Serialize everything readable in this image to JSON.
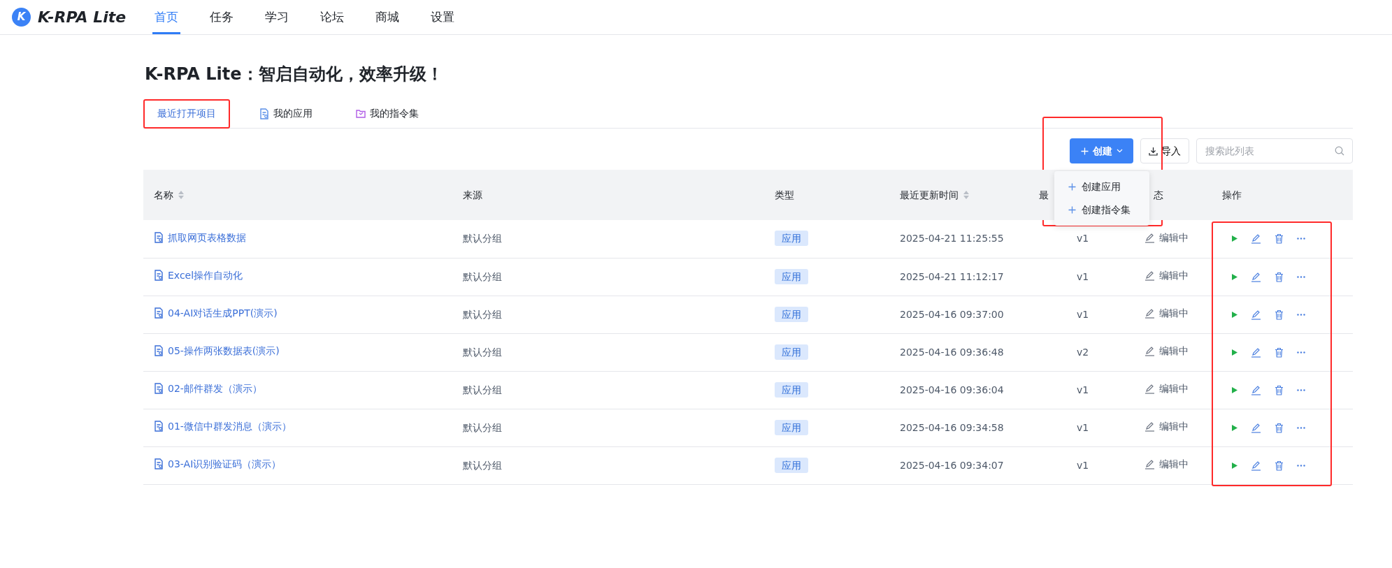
{
  "app": {
    "logo_letter": "K",
    "name": "K-RPA Lite"
  },
  "nav": [
    {
      "label": "首页",
      "selected": true
    },
    {
      "label": "任务",
      "selected": false
    },
    {
      "label": "学习",
      "selected": false
    },
    {
      "label": "论坛",
      "selected": false
    },
    {
      "label": "商城",
      "selected": false
    },
    {
      "label": "设置",
      "selected": false
    }
  ],
  "heading": "K-RPA Lite：智启自动化，效率升级！",
  "tabs": [
    {
      "label": "最近打开项目",
      "kind": "recent",
      "selected": true,
      "highlighted": true
    },
    {
      "label": "我的应用",
      "kind": "app",
      "selected": false,
      "highlighted": false
    },
    {
      "label": "我的指令集",
      "kind": "set",
      "selected": false,
      "highlighted": false
    }
  ],
  "toolbar": {
    "create": {
      "label": "创建",
      "highlighted": true
    },
    "import": {
      "label": "导入"
    },
    "search": {
      "placeholder": "搜索此列表"
    }
  },
  "create_menu": {
    "open": true,
    "items": [
      "创建应用",
      "创建指令集"
    ]
  },
  "table": {
    "actions_highlighted": true,
    "columns": [
      {
        "label": "名称",
        "sortable": true
      },
      {
        "label": "来源",
        "sortable": false
      },
      {
        "label": "类型",
        "sortable": false
      },
      {
        "label": "最近更新时间",
        "sortable": true
      },
      {
        "label": "最",
        "sortable": false
      },
      {
        "label": "态",
        "sortable": false
      },
      {
        "label": "操作",
        "sortable": false
      }
    ],
    "rows": [
      {
        "name": "抓取网页表格数据",
        "source": "默认分组",
        "type": "应用",
        "updated": "2025-04-21 11:25:55",
        "version": "v1",
        "status": "编辑中"
      },
      {
        "name": "Excel操作自动化",
        "source": "默认分组",
        "type": "应用",
        "updated": "2025-04-21 11:12:17",
        "version": "v1",
        "status": "编辑中"
      },
      {
        "name": "04-AI对话生成PPT(演示)",
        "source": "默认分组",
        "type": "应用",
        "updated": "2025-04-16 09:37:00",
        "version": "v1",
        "status": "编辑中"
      },
      {
        "name": "05-操作两张数据表(演示)",
        "source": "默认分组",
        "type": "应用",
        "updated": "2025-04-16 09:36:48",
        "version": "v2",
        "status": "编辑中"
      },
      {
        "name": "02-邮件群发（演示）",
        "source": "默认分组",
        "type": "应用",
        "updated": "2025-04-16 09:36:04",
        "version": "v1",
        "status": "编辑中"
      },
      {
        "name": "01-微信中群发消息（演示）",
        "source": "默认分组",
        "type": "应用",
        "updated": "2025-04-16 09:34:58",
        "version": "v1",
        "status": "编辑中"
      },
      {
        "name": "03-AI识别验证码（演示）",
        "source": "默认分组",
        "type": "应用",
        "updated": "2025-04-16 09:34:07",
        "version": "v1",
        "status": "编辑中"
      }
    ]
  }
}
